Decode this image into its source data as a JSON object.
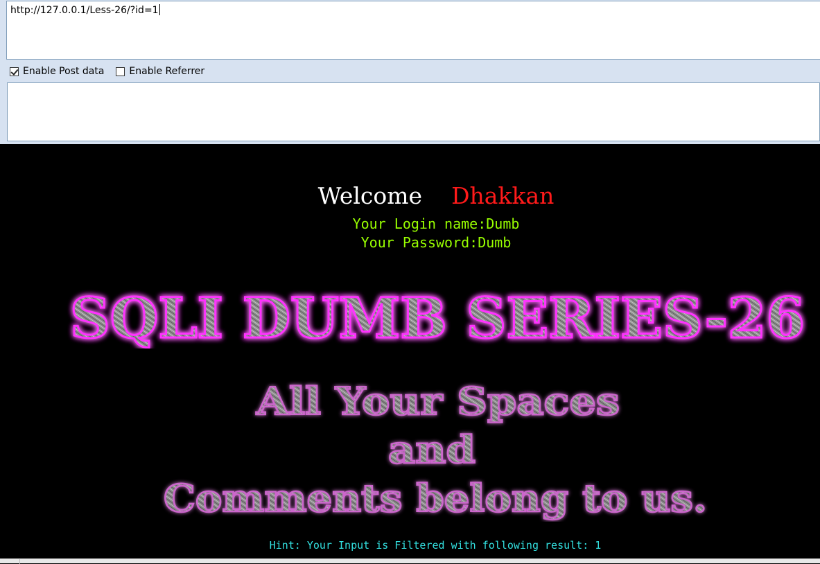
{
  "hackbar": {
    "url_value": "http://127.0.0.1/Less-26/?id=1",
    "post_data_value": "",
    "enable_post_data": {
      "label": "Enable Post data",
      "checked": true
    },
    "enable_referrer": {
      "label": "Enable Referrer",
      "checked": false
    }
  },
  "page": {
    "welcome_word": "Welcome",
    "welcome_name": "Dhakkan",
    "login_line": "Your Login name:Dumb",
    "password_line": "Your Password:Dumb",
    "banner_title": "SQLI DUMB SERIES-26",
    "tagline_line1": "All Your Spaces",
    "tagline_line2": "and",
    "tagline_line3": "Comments belong to us.",
    "hint_line": "Hint: Your Input is Filtered with following result: 1"
  },
  "colors": {
    "page_background": "#000000",
    "welcome_name": "#ff1a1a",
    "credentials": "#99ff00",
    "hint": "#33e0e0",
    "banner_glow": "#ff33ff",
    "tagline_glow": "#cc66cc",
    "metal_fill": "#9a9a9a"
  }
}
